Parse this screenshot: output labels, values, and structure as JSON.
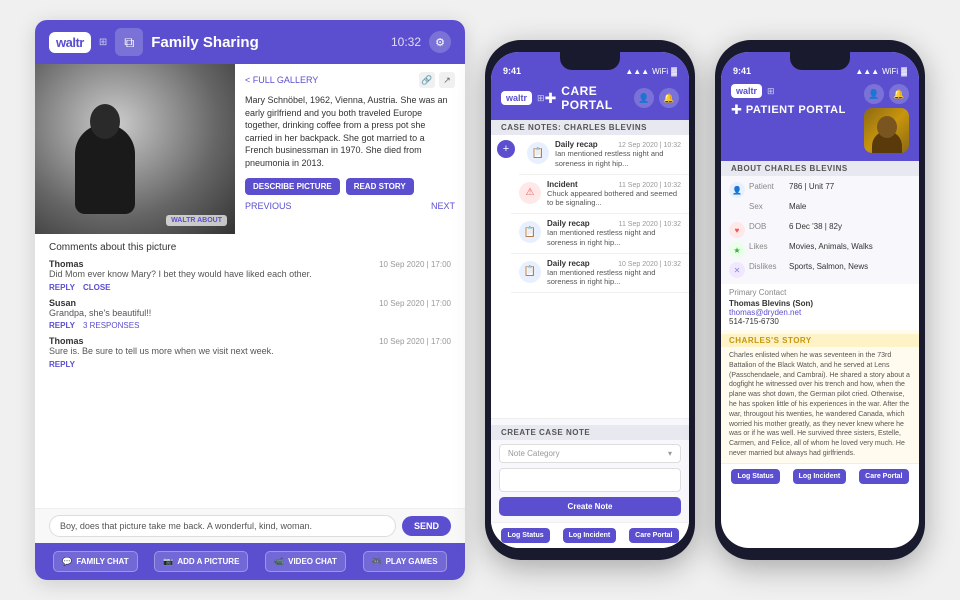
{
  "familyApp": {
    "header": {
      "waltrLabel": "waltr",
      "gridIcon": "⊞",
      "sharingIcon": "⧉",
      "title": "Family Sharing",
      "time": "10:32",
      "settingsIcon": "⚙"
    },
    "gallery": {
      "navLabel": "< FULL GALLERY",
      "linkIcon1": "🔗",
      "linkIcon2": "↗"
    },
    "photoDescription": "Mary Schnöbel, 1962, Vienna, Austria. She was an early girlfriend and you both traveled Europe together, drinking coffee from a press pot she carried in her backpack. She got married to a French businessman in 1970. She died from pneumonia in 2013.",
    "watermark": "WALTR ABOUT",
    "buttons": {
      "describe": "DESCRIBE PICTURE",
      "read": "READ STORY"
    },
    "nav": {
      "previous": "PREVIOUS",
      "next": "NEXT"
    },
    "commentsTitle": "Comments about this picture",
    "comments": [
      {
        "author": "Thomas",
        "time": "10 Sep 2020 | 17:00",
        "text": "Did Mom ever know Mary? I bet they would have liked each other.",
        "actions": [
          "REPLY",
          "CLOSE"
        ]
      },
      {
        "author": "Susan",
        "time": "10 Sep 2020 | 17:00",
        "text": "Grandpa, she's beautiful!!",
        "actions": [
          "REPLY"
        ],
        "responses": "3 RESPONSES"
      },
      {
        "author": "Thomas",
        "time": "10 Sep 2020 | 17:00",
        "text": "Sure is. Be sure to tell us more when we visit next week.",
        "actions": [
          "REPLY"
        ]
      }
    ],
    "messageInput": {
      "placeholder": "Boy, does that picture take me back. A wonderful, kind, woman.",
      "sendLabel": "SEND"
    },
    "footer": {
      "buttons": [
        {
          "icon": "💬",
          "label": "FAMILY CHAT"
        },
        {
          "icon": "📷",
          "label": "ADD A PICTURE"
        },
        {
          "icon": "📹",
          "label": "VIDEO CHAT"
        },
        {
          "icon": "🎮",
          "label": "PLAY GAMES"
        }
      ]
    }
  },
  "carePortal": {
    "statusTime": "9:41",
    "headerTitle": "CARE PORTAL",
    "waltrLabel": "waltr",
    "gridIcon": "⊞",
    "headerIcons": [
      "👤",
      "🔔"
    ],
    "sectionHeader": "CASE NOTES: CHARLES BLEVINS",
    "notes": [
      {
        "type": "Daily recap",
        "date": "12 Sep 2020 | 10:32",
        "text": "Ian mentioned restless night and soreness in right hip...",
        "iconType": "blue",
        "icon": "📋"
      },
      {
        "type": "Incident",
        "date": "11 Sep 2020 | 10:32",
        "text": "Chuck appeared bothered and seemed to be signaling...",
        "iconType": "red",
        "icon": "⚠"
      },
      {
        "type": "Daily recap",
        "date": "11 Sep 2020 | 10:32",
        "text": "Ian mentioned restless night and soreness in right hip...",
        "iconType": "blue",
        "icon": "📋"
      },
      {
        "type": "Daily recap",
        "date": "10 Sep 2020 | 10:32",
        "text": "Ian mentioned restless night and soreness in right hip...",
        "iconType": "blue",
        "icon": "📋"
      }
    ],
    "createNote": {
      "header": "CREATE CASE NOTE",
      "categoryPlaceholder": "Note Category",
      "createBtn": "Create Note"
    },
    "bottomButtons": [
      "Log Status",
      "Log Incident",
      "Care Portal"
    ]
  },
  "patientPortal": {
    "statusTime": "9:41",
    "headerTitle": "PATIENT PORTAL",
    "waltrLabel": "waltr",
    "gridIcon": "⊞",
    "sectionHeader": "ABOUT CHARLES BLEVINS",
    "patient": {
      "unit": "786 | Unit 77",
      "sex": "Male",
      "dob": "6 Dec '38 | 82y",
      "likes": "Movies, Animals, Walks",
      "dislikes": "Sports, Salmon, News"
    },
    "primaryContact": {
      "label": "Primary Contact",
      "name": "Thomas Blevins (Son)",
      "email": "thomas@dryden.net",
      "phone": "514-715-6730"
    },
    "story": {
      "title": "CHARLES'S STORY",
      "text": "Charles enlisted when he was seventeen in the 73rd Battalion of the Black Watch, and he served at Lens (Passchendaele, and Cambrai). He shared a story about a dogfight he witnessed over his trench and how, when the plane was shot down, the German pilot cried. Otherwise, he has spoken little of his experiences in the war. After the war, througout his twenties, he wandered Canada, which worried his mother greatly, as they never knew where he was or if he was well. He survived three sisters, Estelle, Carmen, and Felice, all of whom he loved very much. He never married but always had girlfriends."
    },
    "bottomButtons": [
      "Log Status",
      "Log Incident",
      "Care Portal"
    ]
  }
}
